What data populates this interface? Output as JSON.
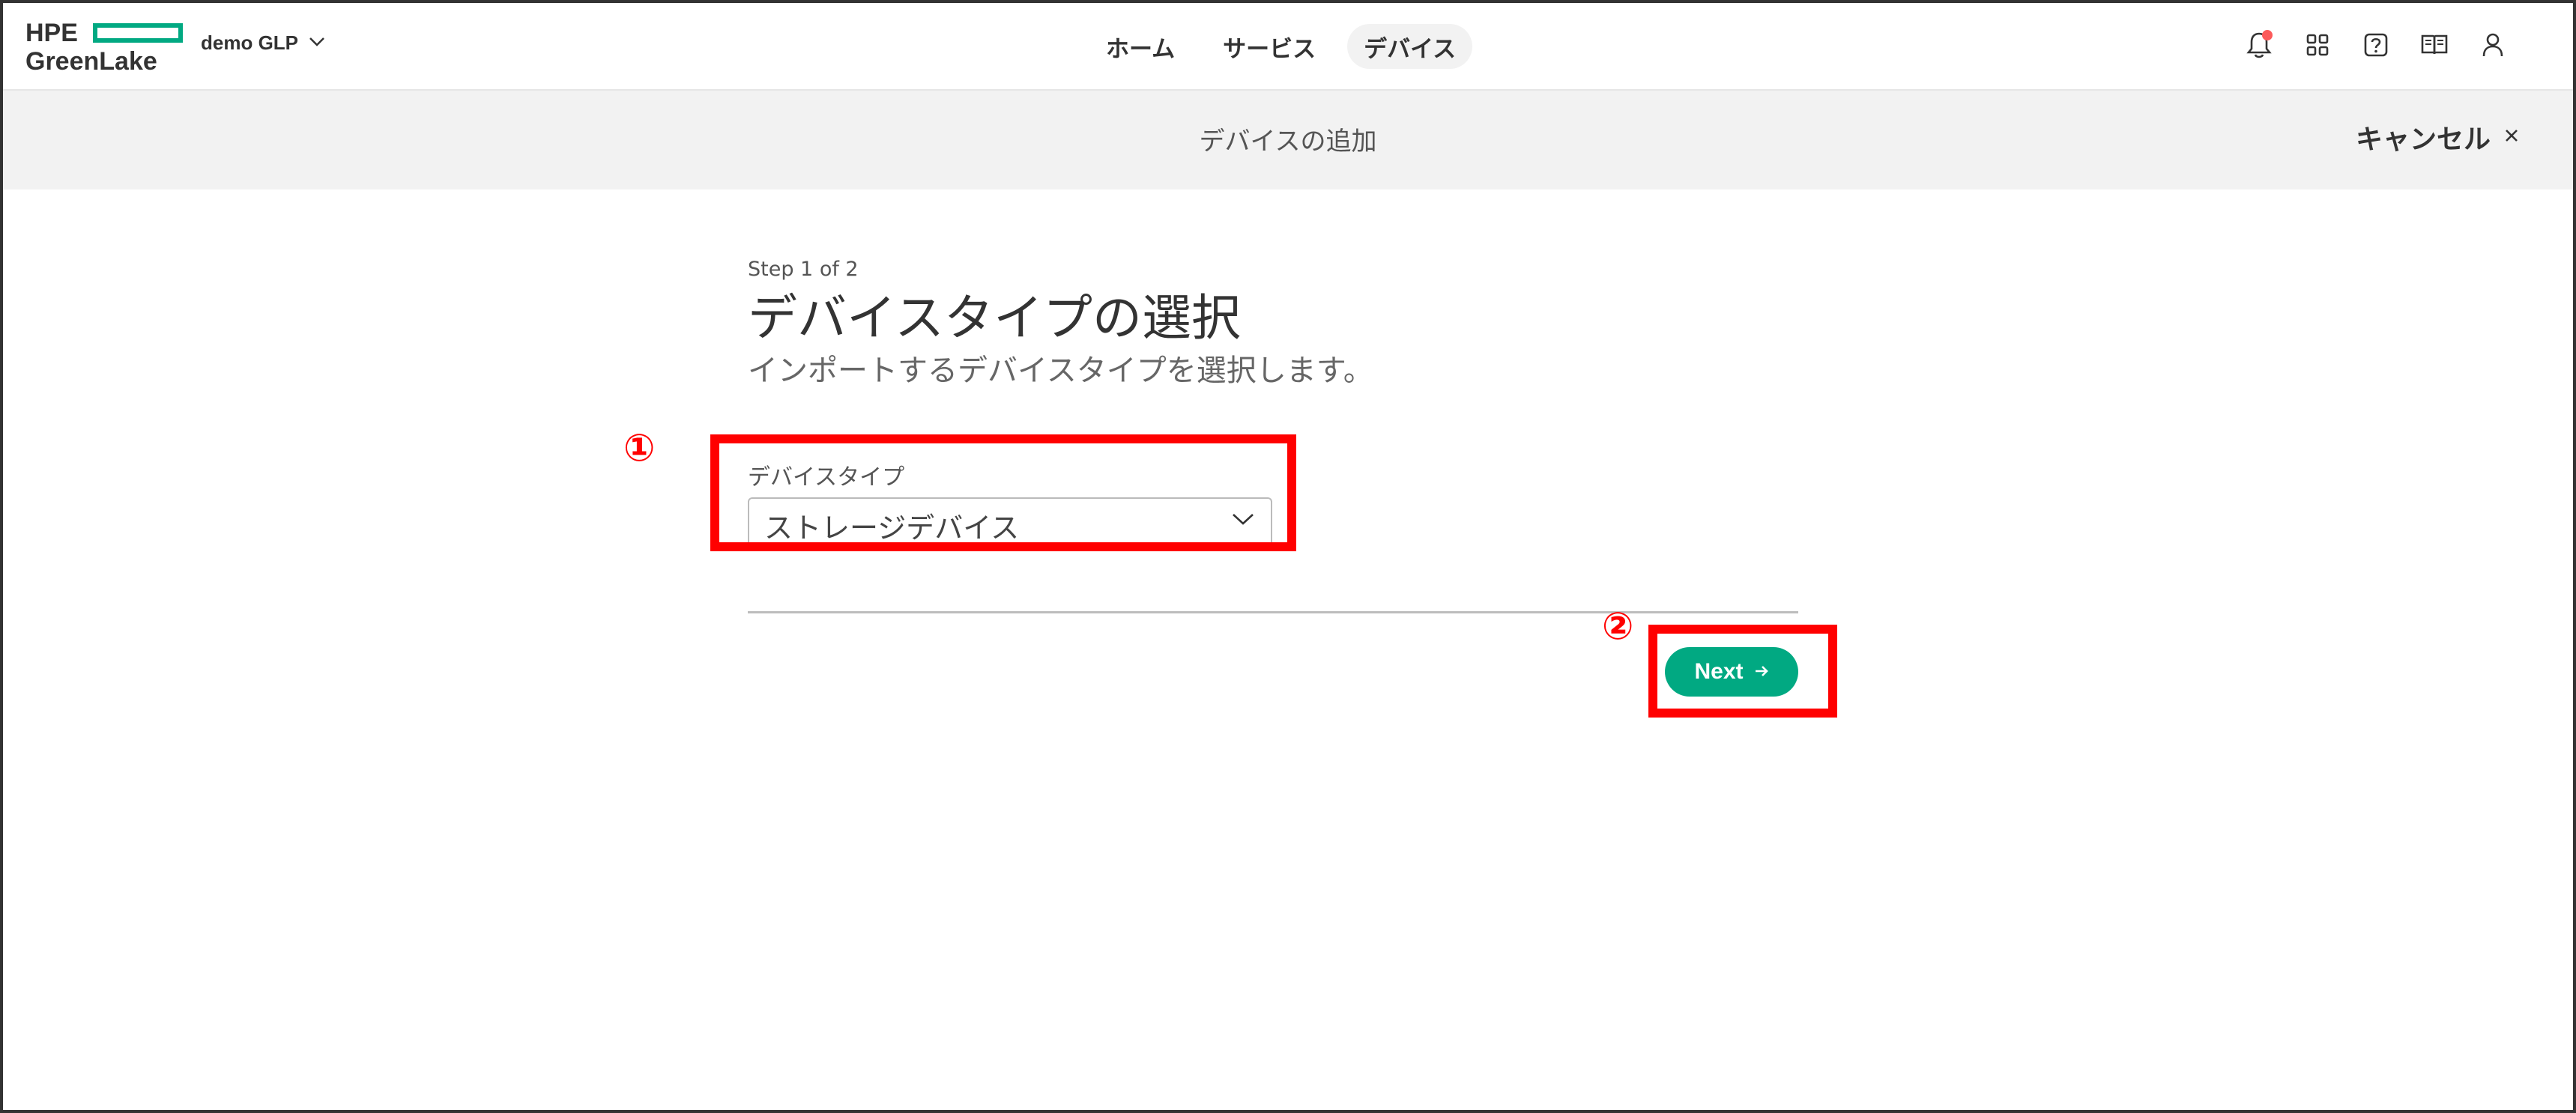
{
  "header": {
    "logo_line1": "HPE",
    "logo_line2": "GreenLake",
    "workspace_label": "demo GLP",
    "nav": [
      {
        "label": "ホーム",
        "active": false
      },
      {
        "label": "サービス",
        "active": false
      },
      {
        "label": "デバイス",
        "active": true
      }
    ],
    "icons": [
      "bell-icon",
      "apps-grid-icon",
      "help-icon",
      "book-icon",
      "user-icon"
    ]
  },
  "subheader": {
    "title": "デバイスの追加",
    "cancel_label": "キャンセル",
    "cancel_icon": "×"
  },
  "form": {
    "step": "Step 1 of 2",
    "title": "デバイスタイプの選択",
    "subtitle": "インポートするデバイスタイプを選択します。",
    "device_type_label": "デバイスタイプ",
    "device_type_value": "ストレージデバイス",
    "next_label": "Next",
    "next_icon": "→"
  },
  "annotations": {
    "marker1": "①",
    "marker2": "②",
    "color": "#ff0000"
  },
  "colors": {
    "brand_green": "#01a982",
    "subheader_bg": "#f2f2f2",
    "notification_dot": "#fc5a5a"
  }
}
